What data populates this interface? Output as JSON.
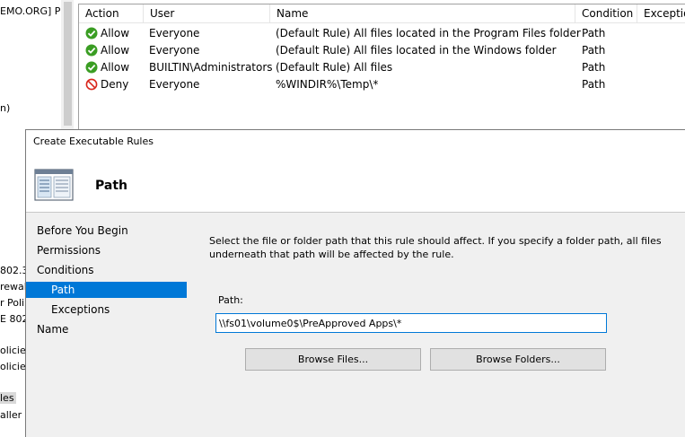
{
  "tree": {
    "items": [
      {
        "text": "EMO.ORG] P"
      },
      {
        "text": "n)"
      },
      {
        "text": "802.3)"
      },
      {
        "text": "rewal"
      },
      {
        "text": "r Poli"
      },
      {
        "text": "E 802"
      },
      {
        "text": "olicie"
      },
      {
        "text": "olicie"
      },
      {
        "text": "les"
      },
      {
        "text": "aller R"
      }
    ]
  },
  "rules": {
    "columns": [
      "Action",
      "User",
      "Name",
      "Condition",
      "Exceptio"
    ],
    "rows": [
      {
        "action": "Allow",
        "icon": "allow-check-icon",
        "user": "Everyone",
        "name": "(Default Rule) All files located in the Program Files folder",
        "condition": "Path"
      },
      {
        "action": "Allow",
        "icon": "allow-check-icon",
        "user": "Everyone",
        "name": "(Default Rule) All files located in the Windows folder",
        "condition": "Path"
      },
      {
        "action": "Allow",
        "icon": "allow-check-icon",
        "user": "BUILTIN\\Administrators",
        "name": "(Default Rule) All files",
        "condition": "Path"
      },
      {
        "action": "Deny",
        "icon": "deny-circle-icon",
        "user": "Everyone",
        "name": "%WINDIR%\\Temp\\*",
        "condition": "Path"
      }
    ]
  },
  "wizard": {
    "title": "Create Executable Rules",
    "heading": "Path",
    "icon": "rules-window-icon",
    "nav": [
      {
        "label": "Before You Begin",
        "sub": false,
        "active": false
      },
      {
        "label": "Permissions",
        "sub": false,
        "active": false
      },
      {
        "label": "Conditions",
        "sub": false,
        "active": false
      },
      {
        "label": "Path",
        "sub": true,
        "active": true
      },
      {
        "label": "Exceptions",
        "sub": true,
        "active": false
      },
      {
        "label": "Name",
        "sub": false,
        "active": false
      }
    ],
    "description": "Select the file or folder path that this rule should affect. If you specify a folder path, all files underneath that path will be affected by the rule.",
    "path_label": "Path:",
    "path_value": "\\\\fs01\\volume0$\\PreApproved Apps\\*",
    "browse_files": "Browse Files...",
    "browse_folders": "Browse Folders..."
  },
  "colors": {
    "accent": "#0078d7",
    "allow": "#3a9d23",
    "deny": "#d9261c",
    "panel": "#f0f0f0"
  }
}
